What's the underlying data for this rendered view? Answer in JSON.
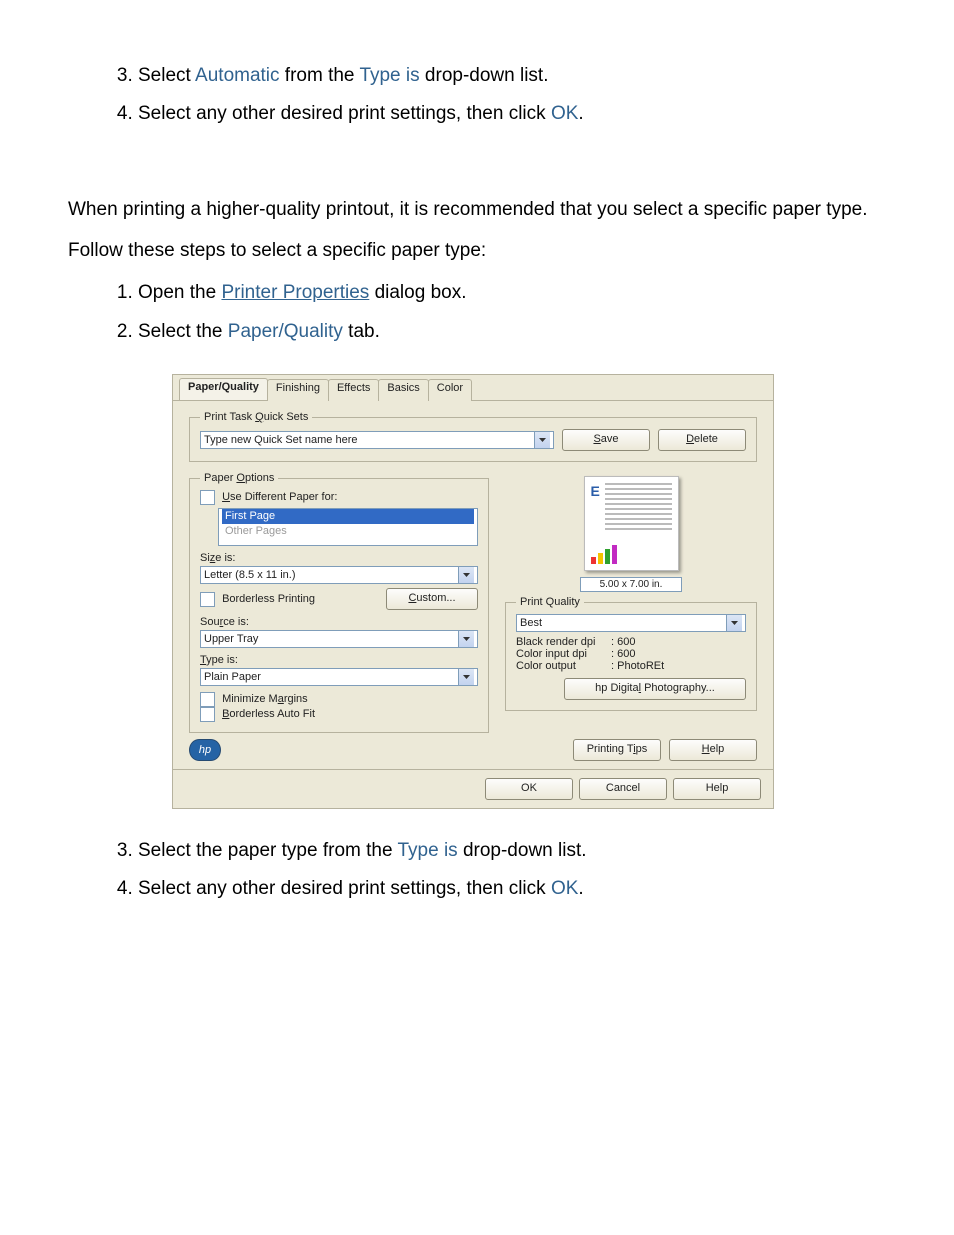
{
  "doc": {
    "list1": {
      "start": 3,
      "item3_a": "Select ",
      "item3_b": "Automatic",
      "item3_c": " from the ",
      "item3_d": "Type is",
      "item3_e": " drop-down list.",
      "item4_a": "Select any other desired print settings, then click ",
      "item4_b": "OK",
      "item4_c": "."
    },
    "para1": "When printing a higher-quality printout, it is recommended that you select a specific paper type.",
    "para2": "Follow these steps to select a specific paper type:",
    "list2": {
      "item1_a": "Open the ",
      "item1_link": "Printer Properties",
      "item1_b": " dialog box.",
      "item2_a": "Select the ",
      "item2_b": "Paper/Quality",
      "item2_c": " tab."
    },
    "list3": {
      "start": 3,
      "item3_a": "Select the paper type from the ",
      "item3_b": "Type is",
      "item3_c": " drop-down list.",
      "item4_a": "Select any other desired print settings, then click ",
      "item4_b": "OK",
      "item4_c": "."
    }
  },
  "dlg": {
    "tabs": [
      "Paper/Quality",
      "Finishing",
      "Effects",
      "Basics",
      "Color"
    ],
    "qs": {
      "legend": "Print Task Quick Sets",
      "placeholder": "Type new Quick Set name here",
      "save": "Save",
      "del": "Delete"
    },
    "po": {
      "legend": "Paper Options",
      "use_diff": "Use Different Paper for:",
      "list": [
        "First Page",
        "Other Pages"
      ],
      "size_label": "Size is:",
      "size_value": "Letter (8.5 x 11 in.)",
      "borderless_printing": "Borderless Printing",
      "custom": "Custom...",
      "source_label": "Source is:",
      "source_value": "Upper Tray",
      "type_label": "Type is:",
      "type_value": "Plain Paper",
      "minimize_margins": "Minimize Margins",
      "borderless_autofit": "Borderless Auto Fit"
    },
    "preview_dims": "5.00 x 7.00 in.",
    "pq": {
      "legend": "Print Quality",
      "value": "Best",
      "black_k": "Black render dpi",
      "black_v": ": 600",
      "color_in_k": "Color input dpi",
      "color_in_v": ": 600",
      "color_out_k": "Color output",
      "color_out_v": ": PhotoREt",
      "photo_btn": "hp Digital Photography..."
    },
    "footer": {
      "tips": "Printing Tips",
      "help": "Help"
    },
    "buttons": {
      "ok": "OK",
      "cancel": "Cancel",
      "help": "Help"
    }
  }
}
